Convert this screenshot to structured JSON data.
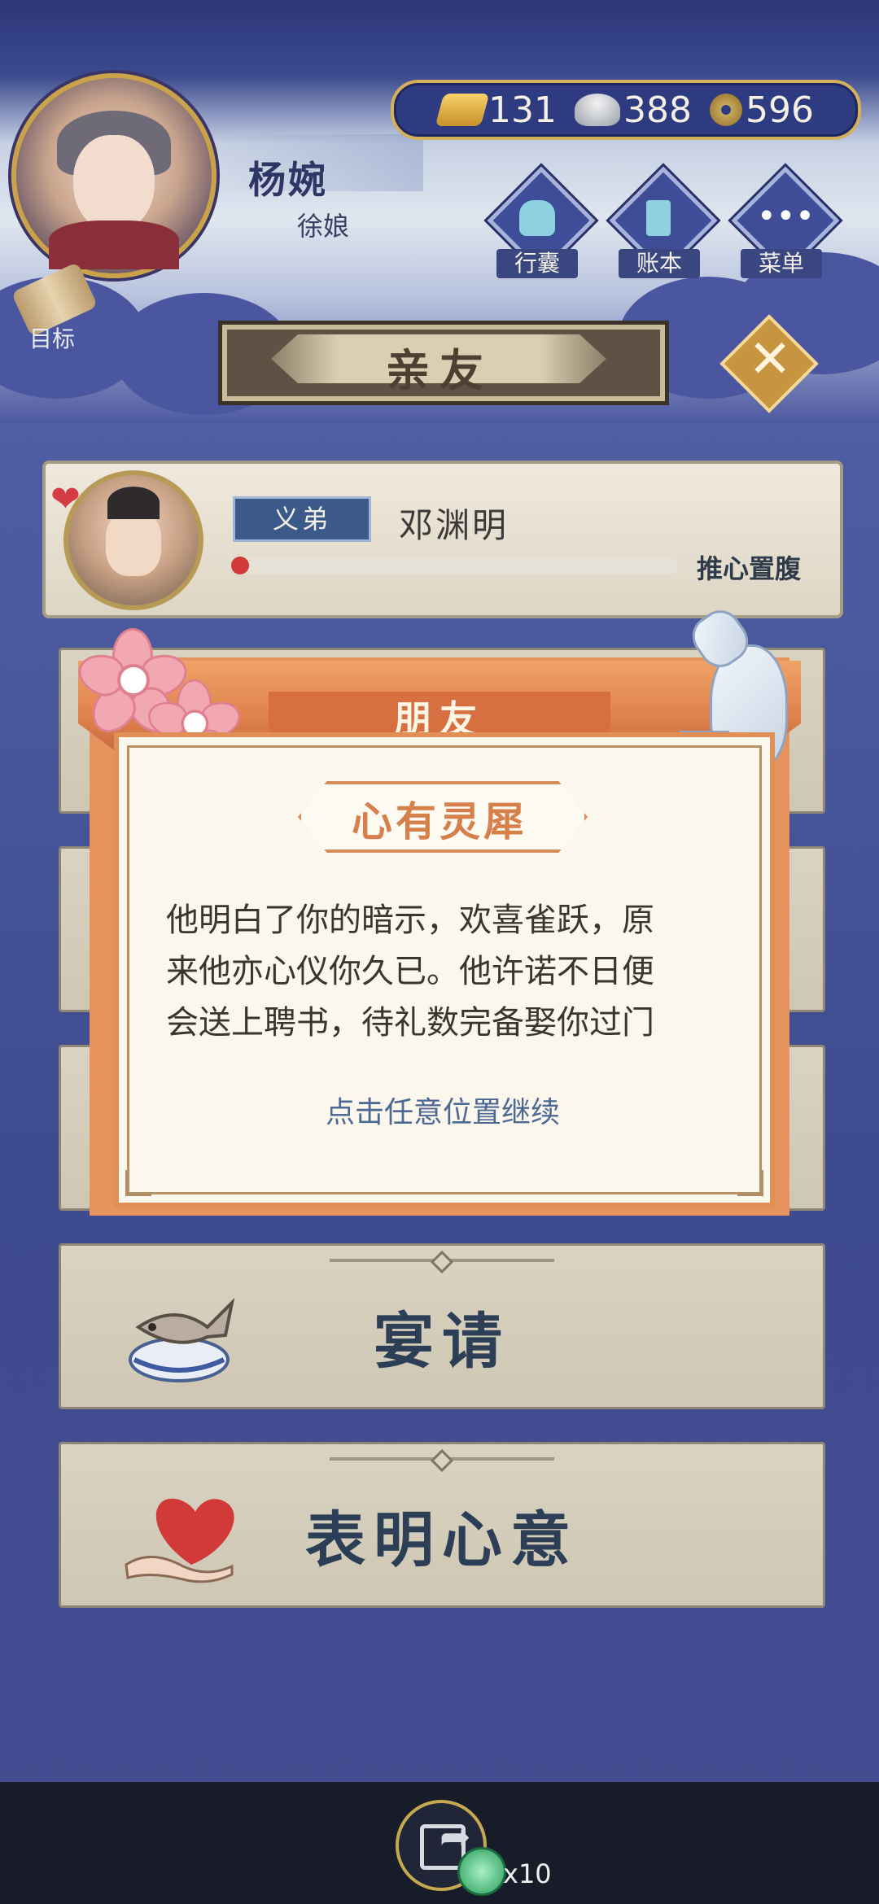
{
  "player": {
    "name": "杨婉",
    "title": "徐娘"
  },
  "currency": {
    "gold": "131",
    "silver": "388",
    "coins": "596"
  },
  "nav": {
    "bag": "行囊",
    "ledger": "账本",
    "menu": "菜单"
  },
  "goal_label": "目标",
  "page_title": "亲友",
  "friend": {
    "relation": "义弟",
    "name": "邓渊明",
    "status": "推心置腹",
    "affinity_progress": 0.03
  },
  "actions": {
    "banquet": "宴请",
    "confess": "表明心意"
  },
  "dialog": {
    "header": "朋友",
    "subtitle": "心有灵犀",
    "lines": [
      "他明白了你的暗示，欢喜雀跃，原",
      "来他亦心仪你久已。他许诺不日便",
      "会送上聘书，待礼数完备娶你过门"
    ],
    "hint": "点击任意位置继续"
  },
  "bottom": {
    "reward_count": "x10"
  },
  "icons": {
    "gold": "gold-ingot-icon",
    "silver": "silver-ingot-icon",
    "coin": "copper-coin-icon",
    "share": "share-icon"
  },
  "colors": {
    "accent_orange": "#e08f57",
    "navy": "#3f4b8f",
    "gold_border": "#c9a24a"
  }
}
